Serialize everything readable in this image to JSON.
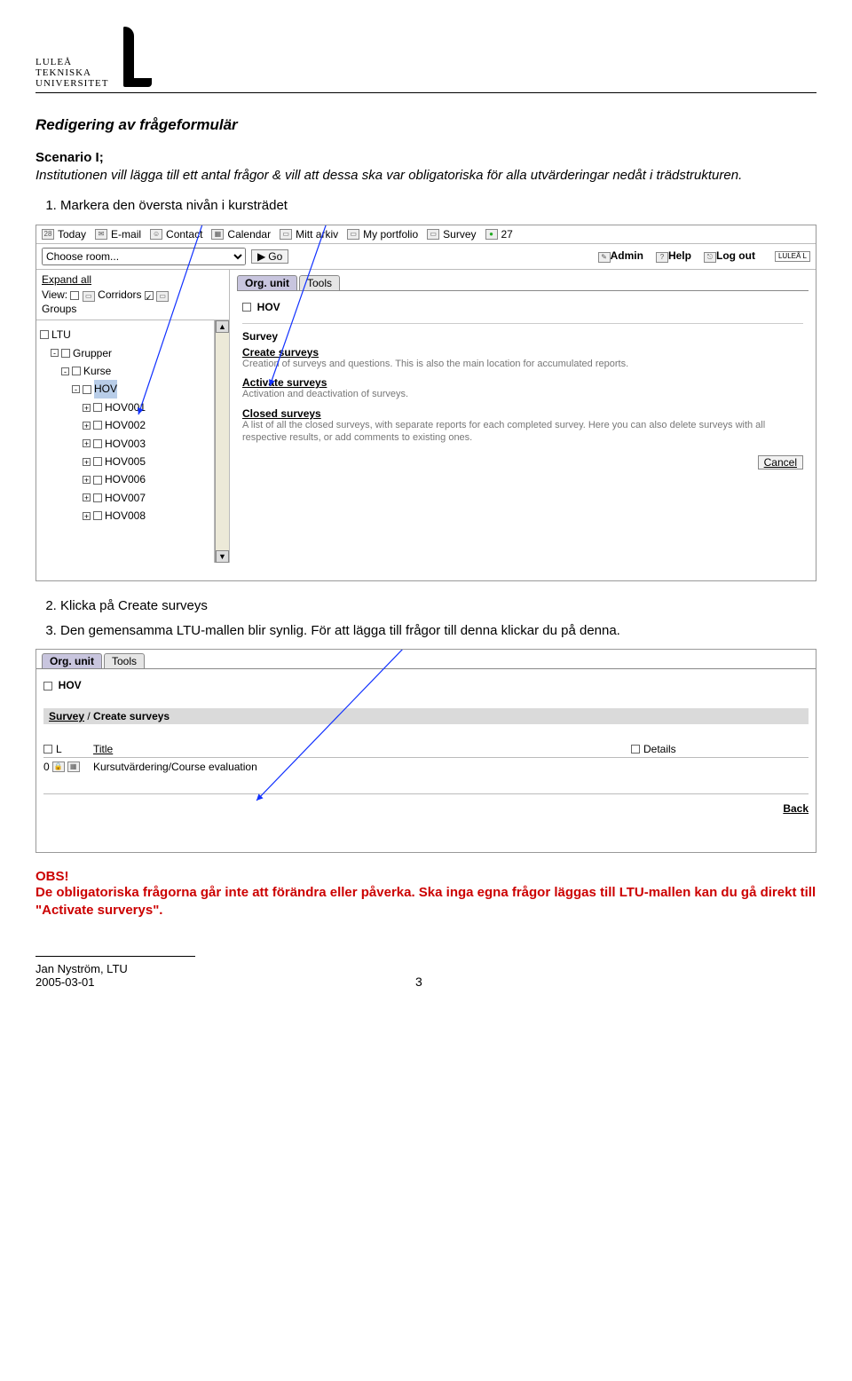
{
  "header": {
    "logo_line1": "LULEÅ",
    "logo_line2": "TEKNISKA",
    "logo_line3": "UNIVERSITET"
  },
  "doc": {
    "title": "Redigering av frågeformulär",
    "scenario_label": "Scenario I;",
    "intro": "Institutionen vill lägga till ett antal frågor & vill att dessa ska var obligatoriska för alla utvärderingar nedåt i trädstrukturen.",
    "step1": "Markera den översta nivån i kursträdet",
    "step2": "Klicka på Create surveys",
    "step3": "Den gemensamma LTU-mallen blir synlig. För att lägga till frågor till denna klickar du på denna.",
    "obs_label": "OBS!",
    "obs_text": "De obligatoriska frågorna går inte att förändra eller påverka. Ska inga egna frågor läggas till LTU-mallen kan du gå direkt till \"Activate surverys\"."
  },
  "shot1": {
    "topnav": [
      "Today",
      "E-mail",
      "Contact",
      "Calendar",
      "Mitt arkiv",
      "My portfolio",
      "Survey"
    ],
    "count": "27",
    "choose_room": "Choose room...",
    "go": "Go",
    "admin": "Admin",
    "help": "Help",
    "logout": "Log out",
    "mini_logo": "LULEÅ L",
    "expand_all": "Expand all",
    "view": "View:",
    "corridors": "Corridors",
    "groups": "Groups",
    "tree": {
      "root": "LTU",
      "n1": "Grupper",
      "n2": "Kurse",
      "sel": "HOV",
      "leaves": [
        "HOV001",
        "HOV002",
        "HOV003",
        "HOV005",
        "HOV006",
        "HOV007",
        "HOV008"
      ]
    },
    "tabs": {
      "org": "Org. unit",
      "tools": "Tools"
    },
    "hov": "HOV",
    "survey": "Survey",
    "links": {
      "create": "Create surveys",
      "create_desc": "Creation of surveys and questions. This is also the main location for accumulated reports.",
      "activate": "Activate surveys",
      "activate_desc": "Activation and deactivation of surveys.",
      "closed": "Closed surveys",
      "closed_desc": "A list of all the closed surveys, with separate reports for each completed survey. Here you can also delete surveys with all respective results, or add comments to existing ones."
    },
    "cancel": "Cancel"
  },
  "shot2": {
    "tabs": {
      "org": "Org. unit",
      "tools": "Tools"
    },
    "hov": "HOV",
    "path_survey": "Survey",
    "path_create": "Create surveys",
    "col_L": "L",
    "col_title": "Title",
    "col_details": "Details",
    "row_lock": "0",
    "row_title": "Kursutvärdering/Course evaluation",
    "back": "Back"
  },
  "footer": {
    "author": "Jan Nyström, LTU",
    "date": "2005-03-01",
    "page": "3"
  }
}
